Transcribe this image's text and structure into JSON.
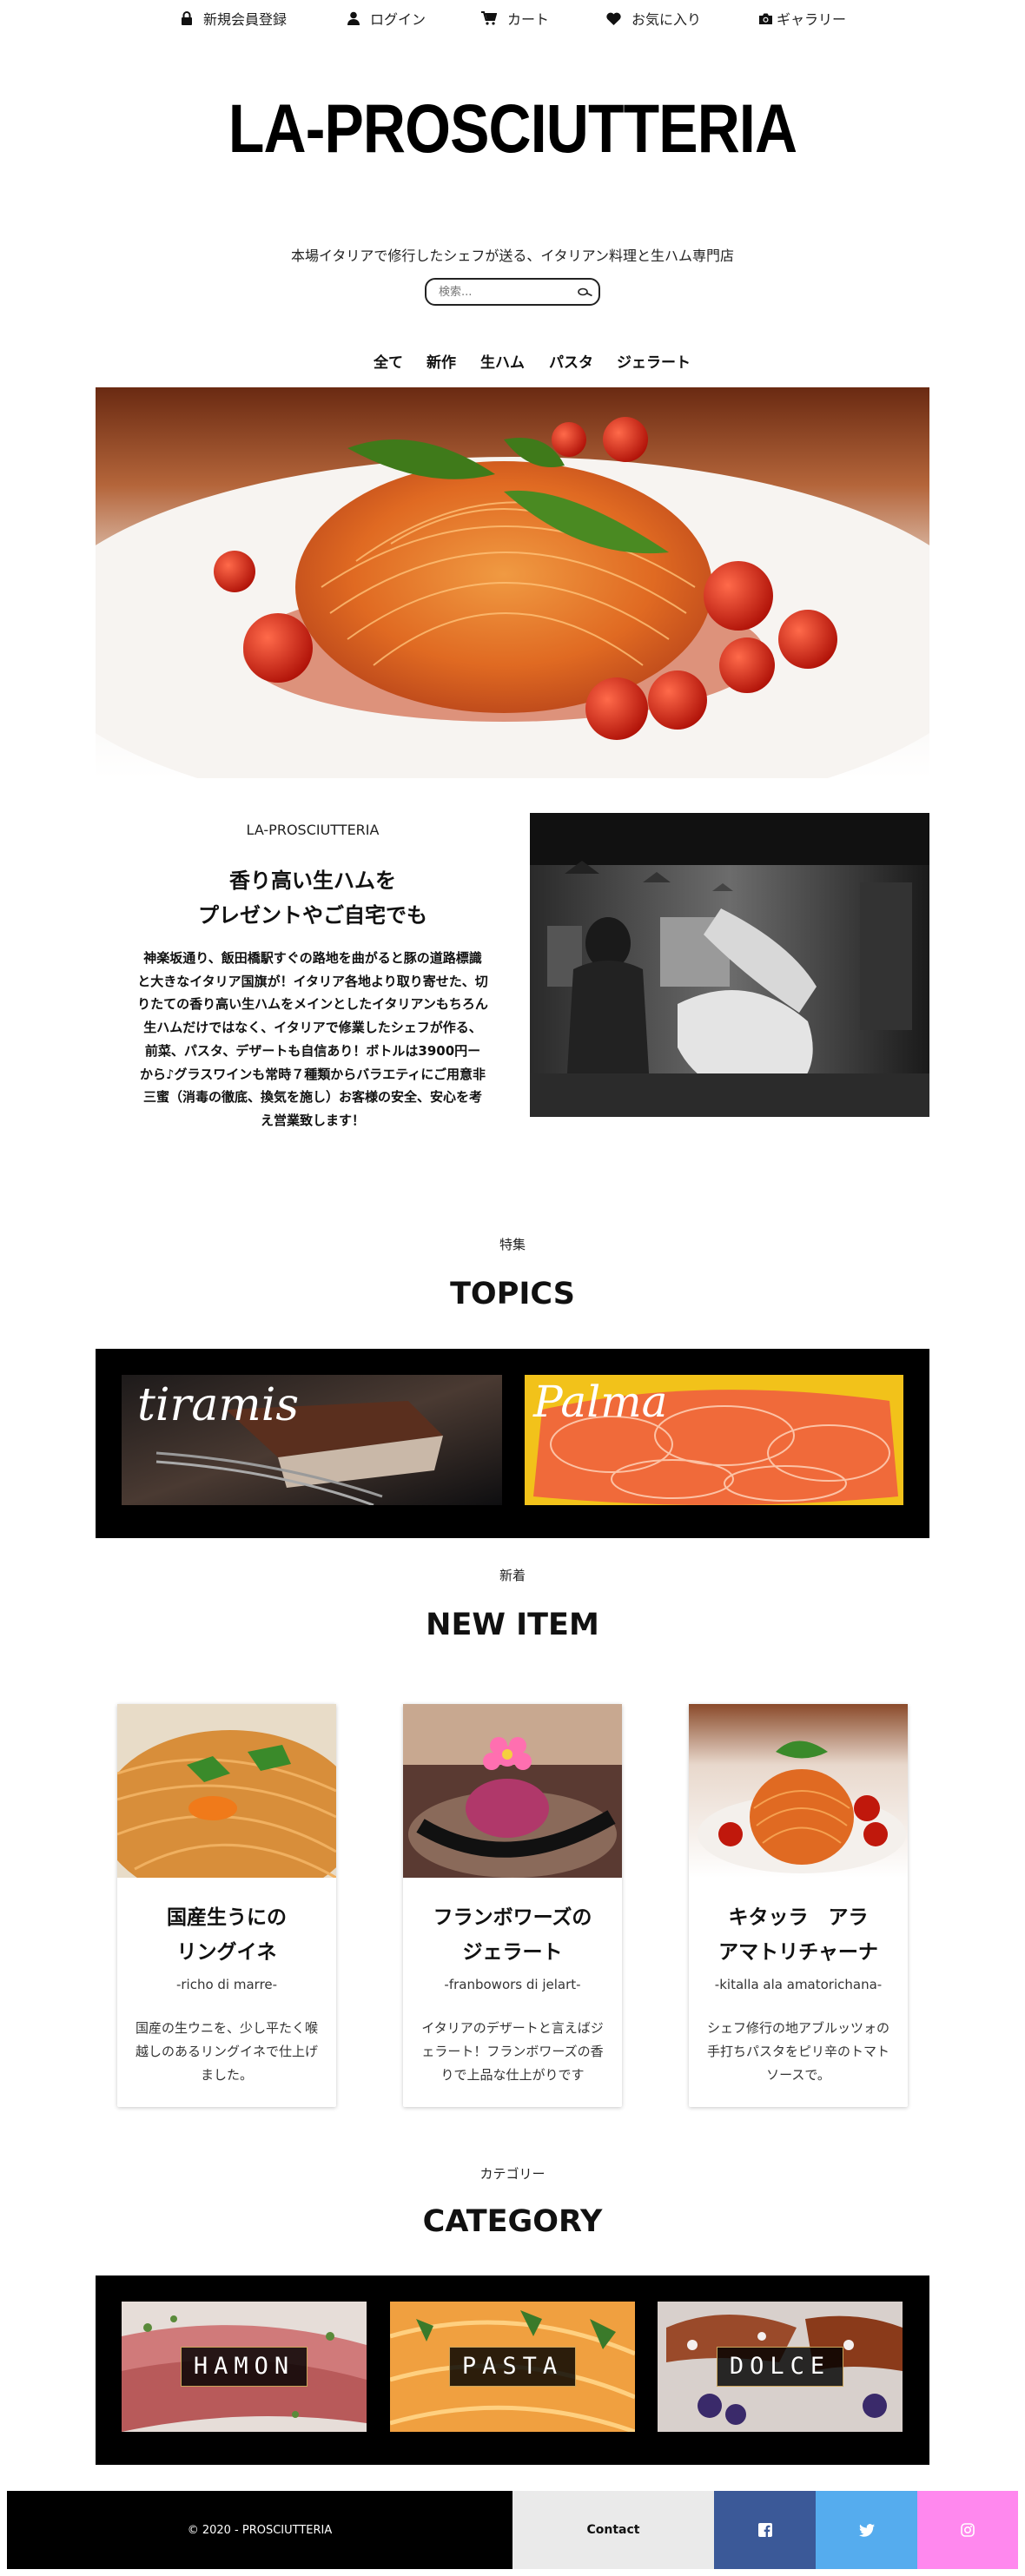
{
  "topnav": {
    "register": "新規会員登録",
    "login": "ログイン",
    "cart": "カート",
    "favorites": "お気に入り",
    "gallery": "ギャラリー"
  },
  "site": {
    "logo": "LA-PROSCIUTTERIA",
    "tagline": "本場イタリアで修行したシェフが送る、イタリアン料理と生ハム専門店",
    "search_placeholder": "検索..."
  },
  "catnav": {
    "all": "全て",
    "new": "新作",
    "ham": "生ハム",
    "pasta": "パスタ",
    "gelato": "ジェラート"
  },
  "about": {
    "label": "LA-PROSCIUTTERIA",
    "heading_line1": "香り高い生ハムを",
    "heading_line2": "プレゼントやご自宅でも",
    "body": "神楽坂通り、飯田橋駅すぐの路地を曲がると豚の道路標識と大きなイタリア国旗が！イタリア各地より取り寄せた、切りたての香り高い生ハムをメインとしたイタリアンもちろん生ハムだけではなく、イタリアで修業したシェフが作る、前菜、パスタ、デザートも自信あり！ボトルは3900円ー から♪グラスワインも常時７種類からバラエティにご用意非三蜜（消毒の徹底、換気を施し）お客様の安全、安心を考え営業致します！"
  },
  "topics": {
    "label_jp": "特集",
    "heading": "TOPICS",
    "banner1": "tiramis",
    "banner2": "Palma"
  },
  "new_items": {
    "label_jp": "新着",
    "heading": "NEW ITEM",
    "items": [
      {
        "title_line1": "国産生うにの",
        "title_line2": "リングイネ",
        "subtitle": "-richo di marre-",
        "desc": "国産の生ウニを、少し平たく喉越しのあるリングイネで仕上げました。"
      },
      {
        "title_line1": "フランボワーズの",
        "title_line2": "ジェラート",
        "subtitle": "-franbowors di jelart-",
        "desc": "イタリアのデザートと言えばジェラート！フランボワーズの香りで上品な仕上がりです"
      },
      {
        "title_line1": "キタッラ　アラ",
        "title_line2": "アマトリチャーナ",
        "subtitle": "-kitalla ala amatorichana-",
        "desc": "シェフ修行の地アブルッツォの手打ちパスタをピリ辛のトマトソースで。"
      }
    ]
  },
  "category": {
    "label_jp": "カテゴリー",
    "heading": "CATEGORY",
    "tiles": [
      "HAMON",
      "PASTA",
      "DOLCE"
    ]
  },
  "footer": {
    "copyright": "© 2020 - PROSCIUTTERIA",
    "contact": "Contact"
  },
  "colors": {
    "black": "#000000",
    "contact_bg": "#eaeaea",
    "facebook": "#3b5998",
    "twitter": "#55acee",
    "instagram": "#ff88ee"
  }
}
